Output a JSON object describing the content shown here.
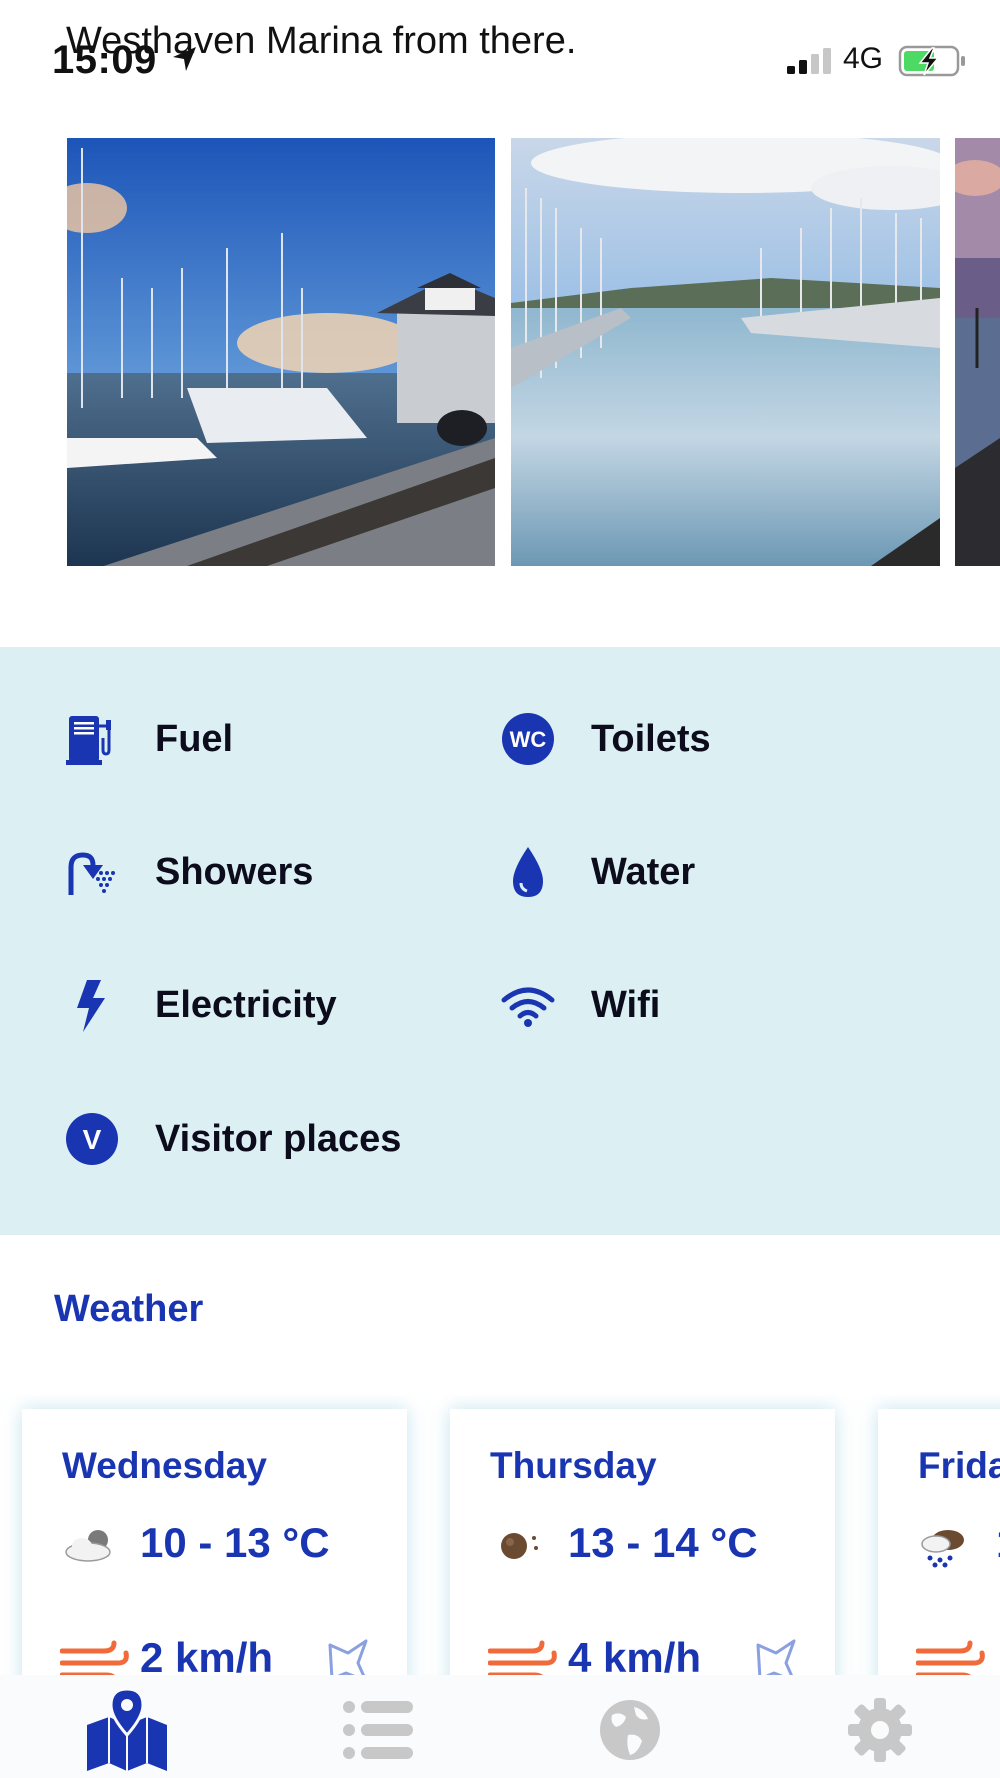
{
  "status_bar": {
    "time": "15:09",
    "network": "4G",
    "clipped_text": "Westhaven Marina from there."
  },
  "facilities": [
    {
      "label": "Fuel",
      "icon": "fuel-pump-icon"
    },
    {
      "label": "Toilets",
      "icon": "wc-icon"
    },
    {
      "label": "Showers",
      "icon": "shower-icon"
    },
    {
      "label": "Water",
      "icon": "water-drop-icon"
    },
    {
      "label": "Electricity",
      "icon": "lightning-icon"
    },
    {
      "label": "Wifi",
      "icon": "wifi-icon"
    },
    {
      "label": "Visitor places",
      "icon": "visitor-v-icon"
    }
  ],
  "weather": {
    "title": "Weather",
    "days": [
      {
        "day": "Wednesday",
        "temp": "10 - 13 °C",
        "wind": "2 km/h",
        "condition_icon": "partly-cloudy-icon"
      },
      {
        "day": "Thursday",
        "temp": "13 - 14 °C",
        "wind": "4 km/h",
        "condition_icon": "sun-icon"
      },
      {
        "day": "Frida",
        "temp": "1",
        "wind": "",
        "condition_icon": "rain-icon"
      }
    ]
  },
  "tabs": [
    {
      "name": "map",
      "icon": "map-icon",
      "active": true
    },
    {
      "name": "list",
      "icon": "list-icon",
      "active": false
    },
    {
      "name": "globe",
      "icon": "globe-icon",
      "active": false
    },
    {
      "name": "settings",
      "icon": "gear-icon",
      "active": false
    }
  ],
  "colors": {
    "accent": "#1a35b2",
    "facility_bg": "#dcf0f3",
    "wind_icon": "#f06a3a",
    "tab_inactive": "#c8c8c8"
  }
}
